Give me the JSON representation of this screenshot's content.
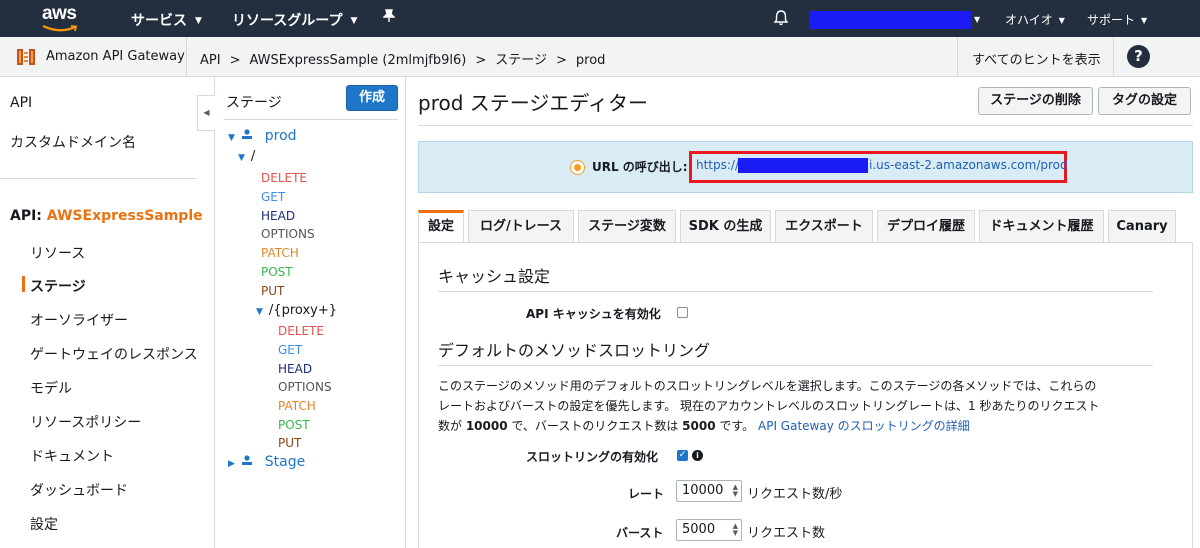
{
  "topnav": {
    "logo": "aws",
    "services": "サービス",
    "resource_groups": "リソースグループ",
    "region": "オハイオ",
    "support": "サポート",
    "icons": [
      "pin-icon",
      "bell-icon"
    ]
  },
  "breadcrumb": {
    "service_name": "Amazon API Gateway",
    "items": [
      "API",
      "AWSExpressSample (2mlmjfb9l6)",
      "ステージ",
      "prod"
    ],
    "separator": ">",
    "show_hints": "すべてのヒントを表示",
    "help": "?"
  },
  "leftnav": {
    "api": "API",
    "custom_domains": "カスタムドメイン名",
    "api_prefix": "API: ",
    "api_name": "AWSExpressSample",
    "items": [
      "リソース",
      "ステージ",
      "オーソライザー",
      "ゲートウェイのレスポンス",
      "モデル",
      "リソースポリシー",
      "ドキュメント",
      "ダッシュボード",
      "設定"
    ],
    "active_item": "ステージ"
  },
  "stages_panel": {
    "title": "ステージ",
    "create_button": "作成",
    "stage1": "prod",
    "root_path": "/",
    "root_methods": [
      "DELETE",
      "GET",
      "HEAD",
      "OPTIONS",
      "PATCH",
      "POST",
      "PUT"
    ],
    "proxy_path": "/{proxy+}",
    "proxy_methods": [
      "DELETE",
      "GET",
      "HEAD",
      "OPTIONS",
      "PATCH",
      "POST",
      "PUT"
    ],
    "stage2": "Stage"
  },
  "main": {
    "title": "prod ステージエディター",
    "delete_stage_button": "ステージの削除",
    "tag_settings_button": "タグの設定",
    "invoke_url_label": "URL の呼び出し:",
    "invoke_url_prefix": "https://",
    "invoke_url_suffix": "i.us-east-2.amazonaws.com/prod",
    "tabs": [
      "設定",
      "ログ/トレース",
      "ステージ変数",
      "SDK の生成",
      "エクスポート",
      "デプロイ履歴",
      "ドキュメント履歴",
      "Canary"
    ],
    "active_tab": "設定",
    "cache_section": "キャッシュ設定",
    "enable_cache_label": "API キャッシュを有効化",
    "enable_cache_checked": false,
    "throttling_section": "デフォルトのメソッドスロットリング",
    "throttling_desc_1": "このステージのメソッド用のデフォルトのスロットリングレベルを選択します。このステージの各メソッドでは、これらの",
    "throttling_desc_2": "レートおよびバーストの設定を優先します。 現在のアカウントレベルのスロットリングレートは、1 秒あたりのリクエスト",
    "throttling_desc_3a": "数が ",
    "throttling_desc_rate": "10000",
    "throttling_desc_3b": " で、バーストのリクエスト数は ",
    "throttling_desc_burst": "5000",
    "throttling_desc_3c": " です。",
    "throttling_link": "API Gateway のスロットリングの詳細",
    "enable_throttling_label": "スロットリングの有効化",
    "enable_throttling_checked": true,
    "rate_label": "レート",
    "rate_value": "10000",
    "rate_unit": "リクエスト数/秒",
    "burst_label": "バースト",
    "burst_value": "5000",
    "burst_unit": "リクエスト数"
  },
  "colors": {
    "topnav_bg": "#232f3e",
    "accent_orange": "#ec7211",
    "primary_blue": "#1f76c8",
    "redaction": "#1b1bf5",
    "highlight_red": "#e8191c"
  }
}
